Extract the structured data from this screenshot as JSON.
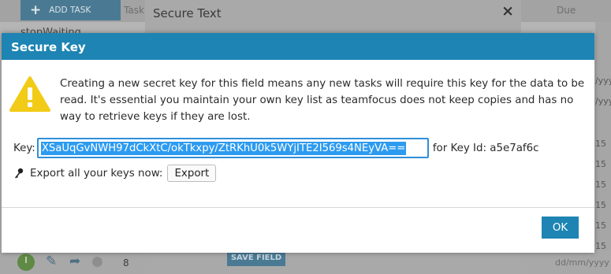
{
  "background": {
    "add_task_label": "ADD TASK",
    "task_column": "Task",
    "due_column": "Due",
    "status": "stopWaiting",
    "right_col": [
      "/yyy",
      "/yyy",
      "15",
      "15",
      "15",
      "15",
      "15",
      "15",
      "/yyy"
    ],
    "row_count": "8",
    "save_field_label": "SAVE FIELD",
    "date_placeholder": "dd/mm/yyyy"
  },
  "secure_text_dialog": {
    "title": "Secure Text",
    "close_glyph": "×"
  },
  "secure_key_modal": {
    "title": "Secure Key",
    "warning": "Creating a new secret key for this field means any new tasks will require this key for the data to be read. It's essential you maintain your own key list as teamfocus does not keep copies and has no way to retrieve keys if they are lost.",
    "key_label": "Key:",
    "key_value": "XSaUqGvNWH97dCkXtC/okTkxpy/ZtRKhU0k5WYjITE2I569s4NEyVA==",
    "key_id_label": "for Key Id: a5e7af6c",
    "export_label": "Export all your keys now:",
    "export_button": "Export",
    "ok_button": "OK"
  },
  "colors": {
    "header": "#1d84b3",
    "ok_button": "#1d84b3",
    "warning_yellow": "#f2cb17",
    "selection": "#2d9bf0"
  },
  "icons": {
    "warning": "warning-triangle-icon",
    "key": "key-icon",
    "close": "close-icon",
    "add": "plus-icon"
  }
}
